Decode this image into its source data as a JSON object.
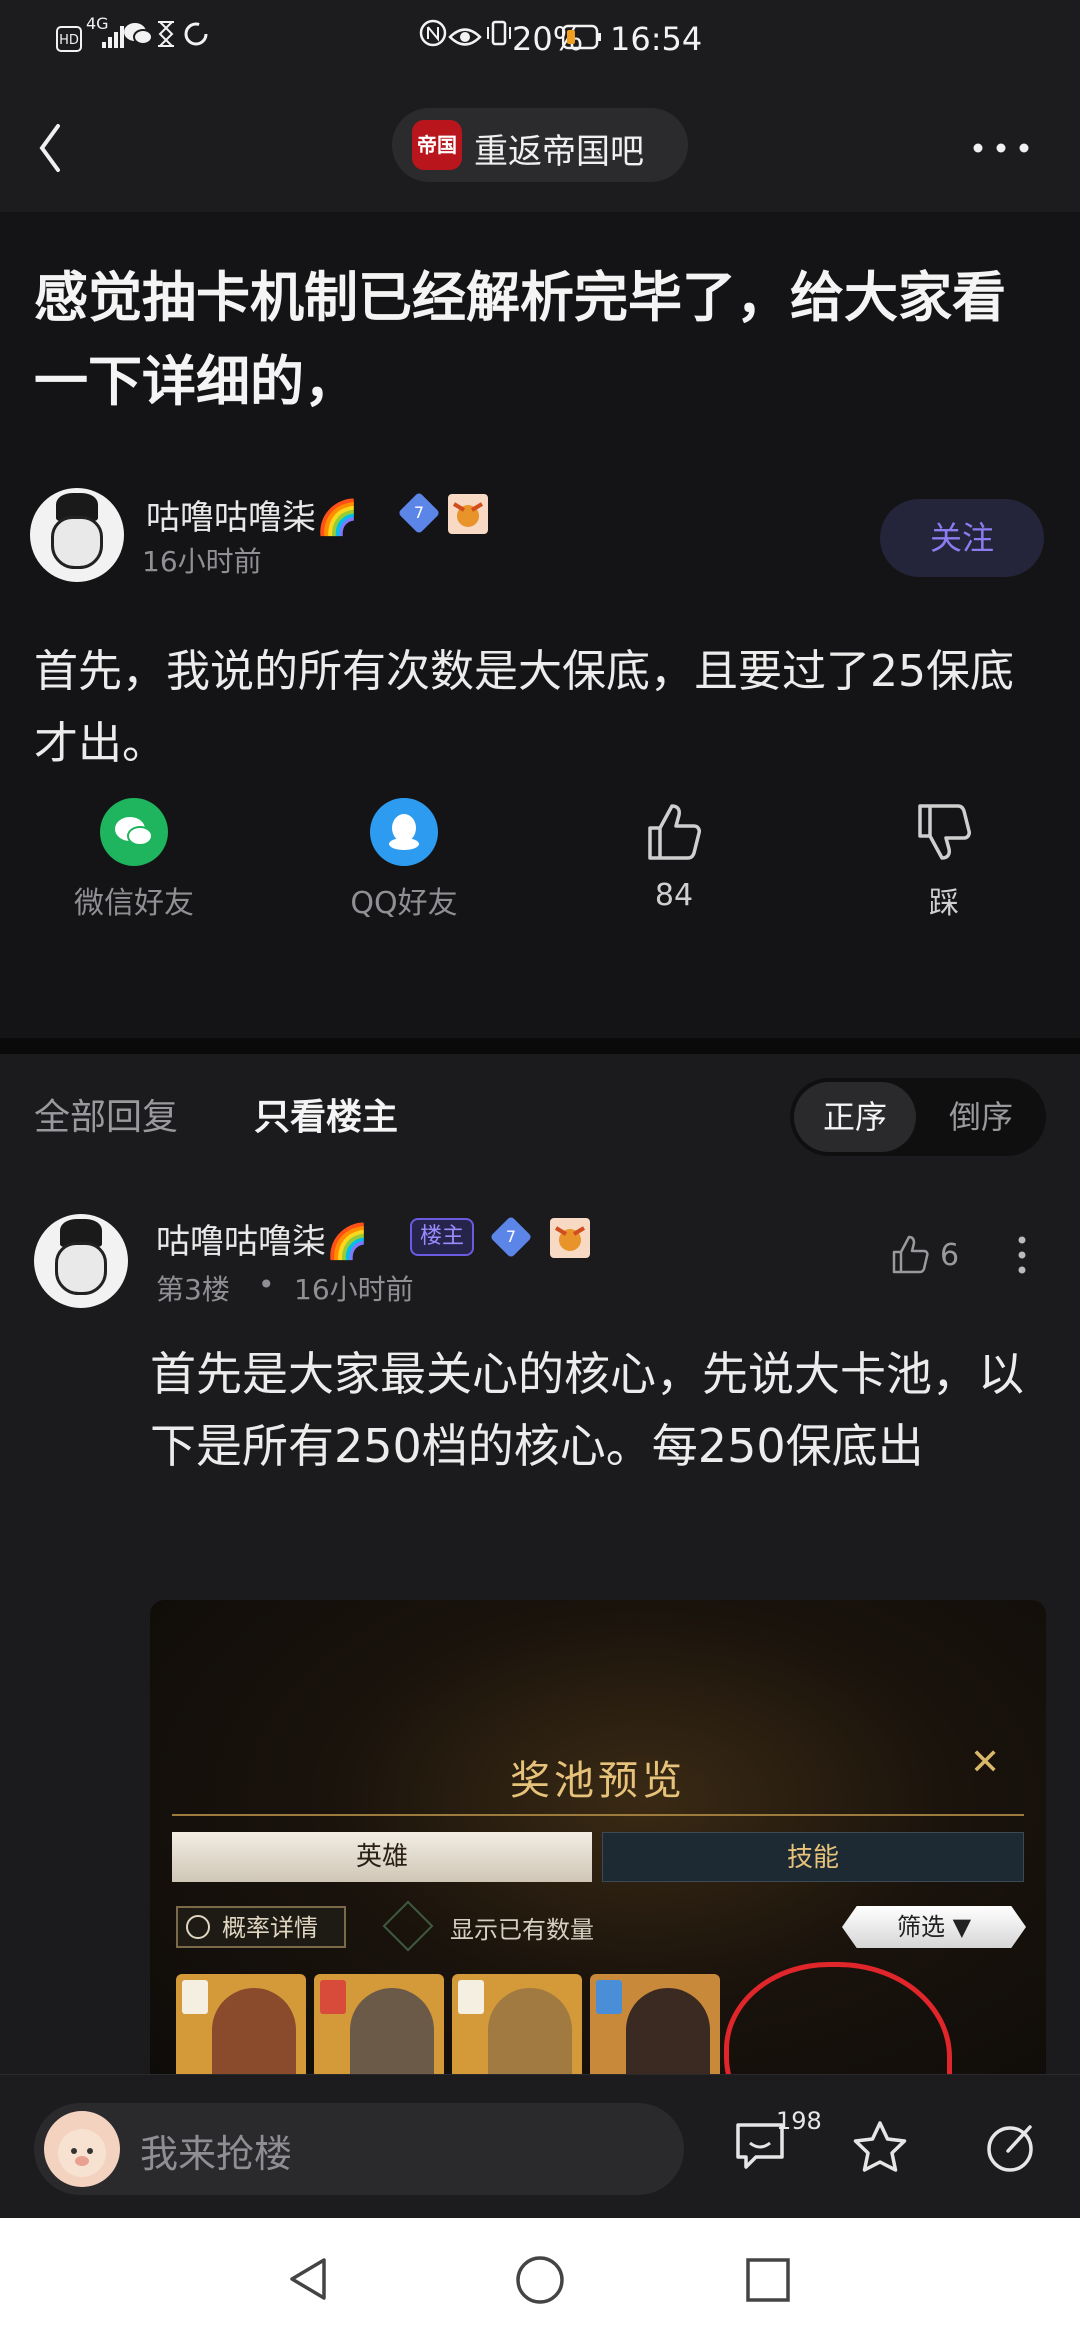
{
  "status_bar": {
    "left_icons": [
      "hd-icon",
      "signal-4g-icon",
      "wechat-icon",
      "hourglass-icon",
      "sync-icon"
    ],
    "network": "4G",
    "battery_percent": "20%",
    "time": "16:54"
  },
  "nav": {
    "forum_logo_text": "帝国",
    "forum_name": "重返帝国吧"
  },
  "post": {
    "title": "感觉抽卡机制已经解析完毕了，给大家看一下详细的，",
    "author": {
      "name": "咕噜咕噜柒🌈",
      "level": "7",
      "time": "16小时前"
    },
    "follow_label": "关注",
    "body": "首先，我说的所有次数是大保底，且要过了25保底才出。",
    "share": {
      "wechat_label": "微信好友",
      "qq_label": "QQ好友",
      "like_count": "84",
      "dislike_label": "踩"
    }
  },
  "replies": {
    "tab_all": "全部回复",
    "tab_owner": "只看楼主",
    "sort_asc": "正序",
    "sort_desc": "倒序",
    "items": [
      {
        "name": "咕噜咕噜柒🌈",
        "owner_badge": "楼主",
        "level": "7",
        "floor": "第3楼",
        "separator": "•",
        "time": "16小时前",
        "likes": "6",
        "body": "首先是大家最关心的核心，先说大卡池，以下是所有250档的核心。每250保底出",
        "image": {
          "title": "奖池预览",
          "tab_hero": "英雄",
          "tab_skill": "技能",
          "prob_label": "概率详情",
          "show_owned": "显示已有数量",
          "filter": "筛选"
        }
      }
    ]
  },
  "bottom": {
    "placeholder": "我来抢楼",
    "reply_count": "198"
  },
  "colors": {
    "accent": "#8c7cf0",
    "background": "#1b1b1d",
    "post_background": "#141416",
    "highlight_red": "#e0262b"
  }
}
